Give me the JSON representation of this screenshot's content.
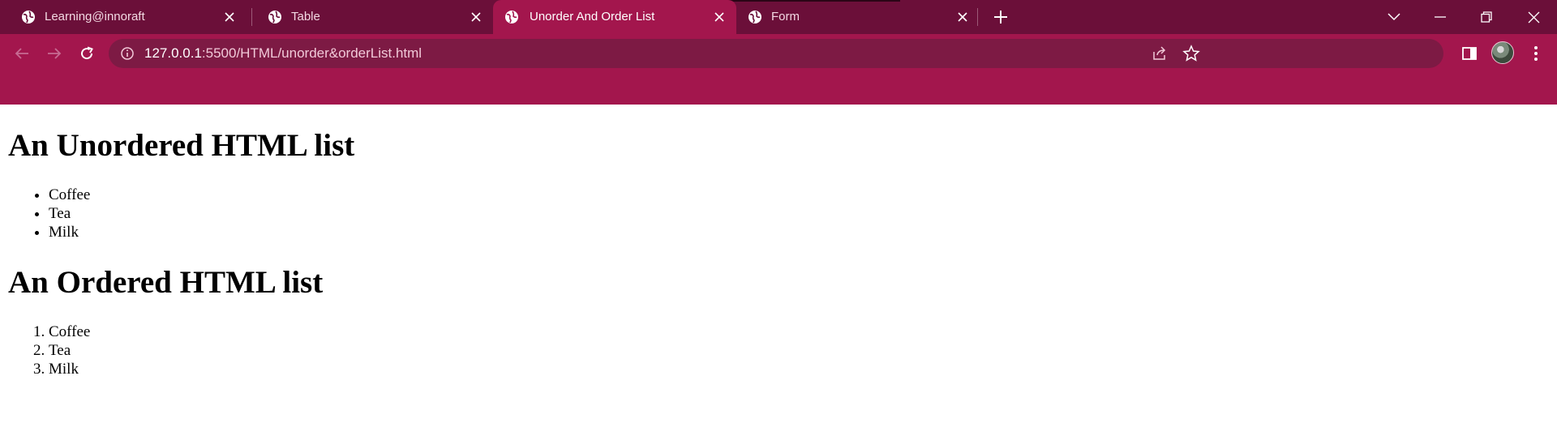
{
  "browser": {
    "tabs": [
      {
        "title": "Learning@innoraft",
        "active": false
      },
      {
        "title": "Table",
        "active": false
      },
      {
        "title": "Unorder And Order List",
        "active": true
      },
      {
        "title": "Form",
        "active": false
      }
    ],
    "address": {
      "host": "127.0.0.1",
      "rest": ":5500/HTML/unorder&orderList.html"
    },
    "colors": {
      "tabstrip": "#6b0f39",
      "toolbar": "#a3164d",
      "omnibox": "#7d1a44"
    },
    "icons": {
      "tab": "globe-icon",
      "close": "close-icon",
      "new_tab": "plus-icon",
      "tab_search": "chevron-down-icon",
      "minimize": "minimize-icon",
      "restore": "restore-icon",
      "close_window": "close-icon",
      "back": "arrow-left-icon",
      "forward": "arrow-right-icon",
      "reload": "reload-icon",
      "site_info": "info-icon",
      "share": "share-icon",
      "bookmark": "star-icon",
      "side_panel": "side-panel-icon",
      "menu": "more-vertical-icon"
    }
  },
  "page": {
    "unordered": {
      "heading": "An Unordered HTML list",
      "items": [
        "Coffee",
        "Tea",
        "Milk"
      ]
    },
    "ordered": {
      "heading": "An Ordered HTML list",
      "items": [
        "Coffee",
        "Tea",
        "Milk"
      ]
    }
  }
}
